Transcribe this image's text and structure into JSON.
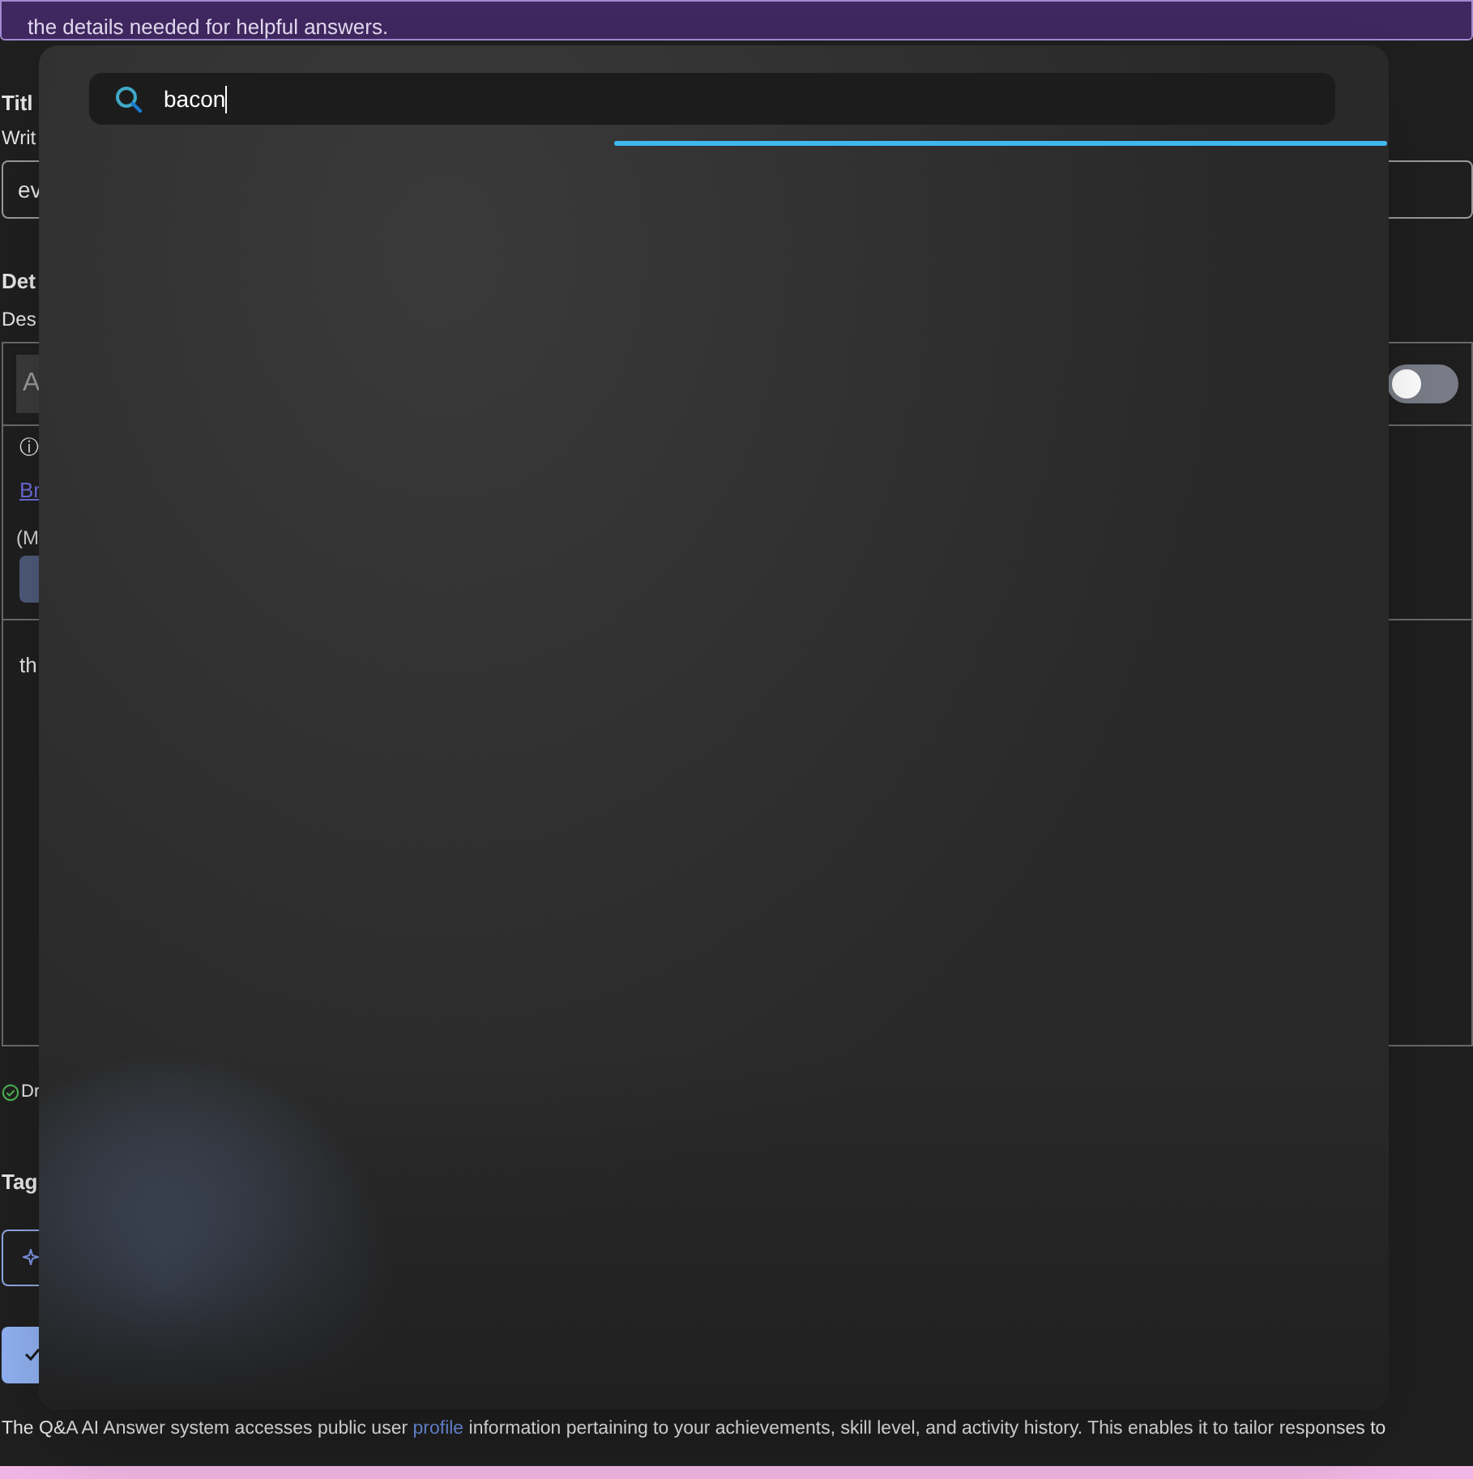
{
  "banner": {
    "text": "the details needed for helpful answers."
  },
  "form": {
    "title_label": "Titl",
    "title_hint": "Writ",
    "title_value": "ev",
    "details_label": "Det",
    "details_hint": "Des",
    "editor": {
      "toolbar_button": "A",
      "toggle": {
        "on": false
      },
      "info_text": "ⓘ",
      "link": "Br",
      "note": "(M",
      "body_text": "th"
    },
    "draft_status": "Dr",
    "tags_label": "Tag"
  },
  "search_popup": {
    "query": "bacon"
  },
  "footer": {
    "before_link": "The Q&A AI Answer system accesses public user ",
    "link": "profile",
    "after_link": " information pertaining to your achievements, skill level, and activity history. This enables it to tailor responses to"
  }
}
